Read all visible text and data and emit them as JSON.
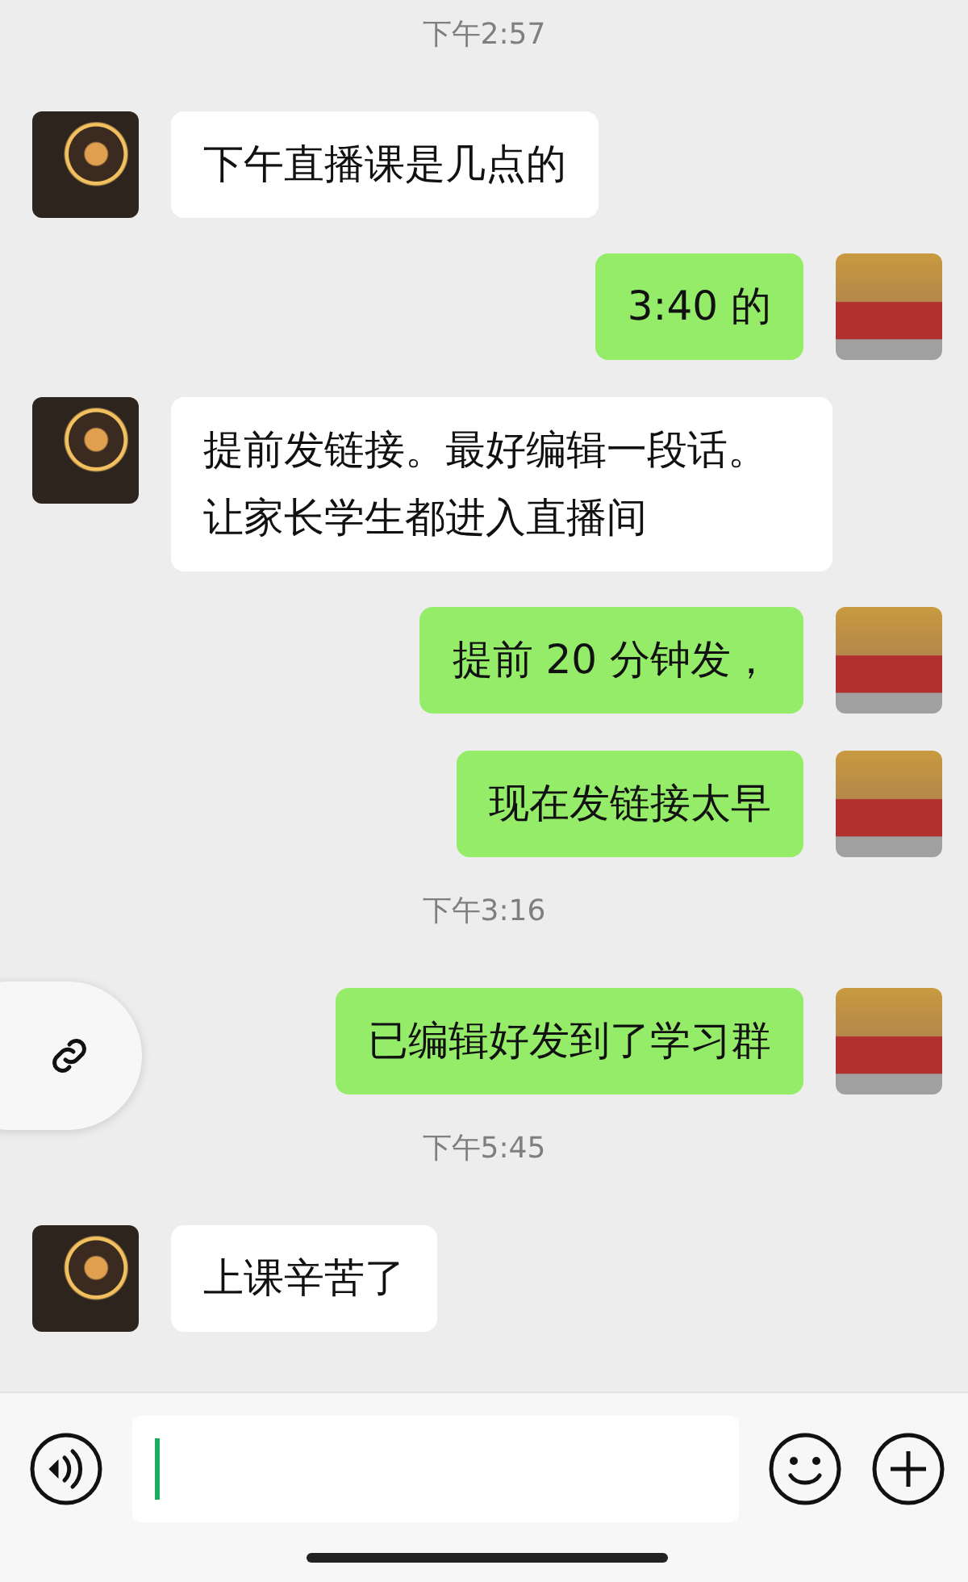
{
  "messages": [
    {
      "kind": "time",
      "text": "下午2:57"
    },
    {
      "kind": "message",
      "outgoing": false,
      "text": "下午直播课是几点的"
    },
    {
      "kind": "message",
      "outgoing": true,
      "text": "3:40 的"
    },
    {
      "kind": "message",
      "outgoing": false,
      "text": "提前发链接。最好编辑一段话。让家长学生都进入直播间"
    },
    {
      "kind": "message",
      "outgoing": true,
      "text": "提前 20 分钟发，"
    },
    {
      "kind": "message",
      "outgoing": true,
      "text": "现在发链接太早"
    },
    {
      "kind": "time",
      "text": "下午3:16"
    },
    {
      "kind": "message",
      "outgoing": true,
      "text": "已编辑好发到了学习群"
    },
    {
      "kind": "time",
      "text": "下午5:45"
    },
    {
      "kind": "message",
      "outgoing": false,
      "text": "上课辛苦了"
    }
  ]
}
